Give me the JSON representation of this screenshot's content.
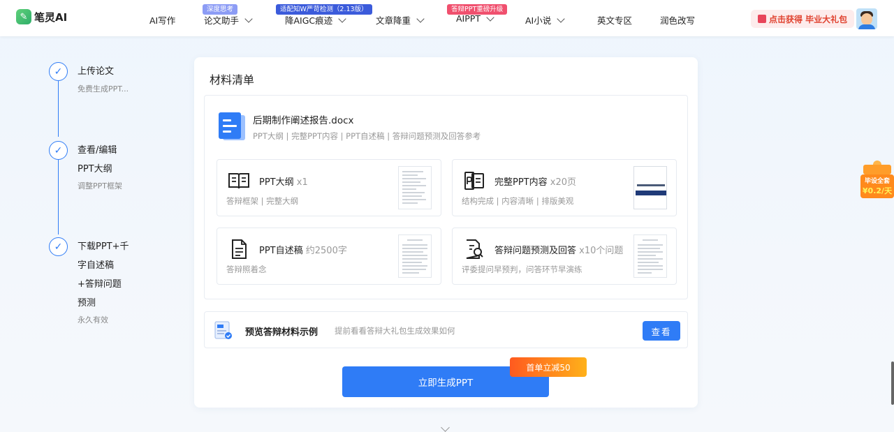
{
  "app": {
    "logo": "笔灵AI",
    "logo_glyph": "✎"
  },
  "nav": {
    "items": [
      {
        "label": "AI写作"
      },
      {
        "label": "论文助手",
        "badge": "深度思考",
        "badge_color": "#8c9cf5"
      },
      {
        "label": "降AIGC痕迹",
        "badge": "适配知W严苛检测（2.13版）",
        "badge_color": "#3b5bdb"
      },
      {
        "label": "文章降重"
      },
      {
        "label": "AIPPT",
        "badge": "答辩PPT重磅升级",
        "badge_color": "#f0506e"
      },
      {
        "label": "AI小说"
      },
      {
        "label": "英文专区"
      },
      {
        "label": "润色改写"
      }
    ],
    "promo": "点击获得 毕业大礼包"
  },
  "steps": [
    {
      "title": "上传论文",
      "sub": "免费生成PPT..."
    },
    {
      "title_lines": [
        "查看/编辑",
        "PPT大纲"
      ],
      "sub": "调整PPT框架"
    },
    {
      "title_lines": [
        "下载PPT+千",
        "字自述稿",
        "+答辩问题",
        "预测"
      ],
      "sub": "永久有效"
    }
  ],
  "card": {
    "title": "材料清单",
    "file": {
      "name": "后期制作阐述报告.docx",
      "tags": "PPT大纲 | 完整PPT内容 | PPT自述稿 | 答辩问题预测及回答参考"
    },
    "items": [
      {
        "name": "PPT大纲",
        "qty": "x1",
        "desc": "答辩框架 | 完整大纲",
        "icon": "book-icon"
      },
      {
        "name": "完整PPT内容",
        "qty": "x20页",
        "desc": "结构完成 | 内容清晰 | 排版美观",
        "icon": "ppt-icon"
      },
      {
        "name": "PPT自述稿",
        "qty": "约2500字",
        "desc": "答辩照着念",
        "icon": "document-icon"
      },
      {
        "name": "答辩问题预测及回答",
        "qty": "x10个问题",
        "desc": "评委提问早预判，问答环节早演练",
        "icon": "search-document-icon"
      }
    ],
    "preview": {
      "label": "预览答辩材料示例",
      "hint": "提前看看答辩大礼包生成效果如何",
      "button": "查看"
    },
    "generate_button": "立即生成PPT",
    "discount": "首单立减50"
  },
  "side_gift": {
    "line1": "毕设全套",
    "line2": "¥0.2/天"
  }
}
